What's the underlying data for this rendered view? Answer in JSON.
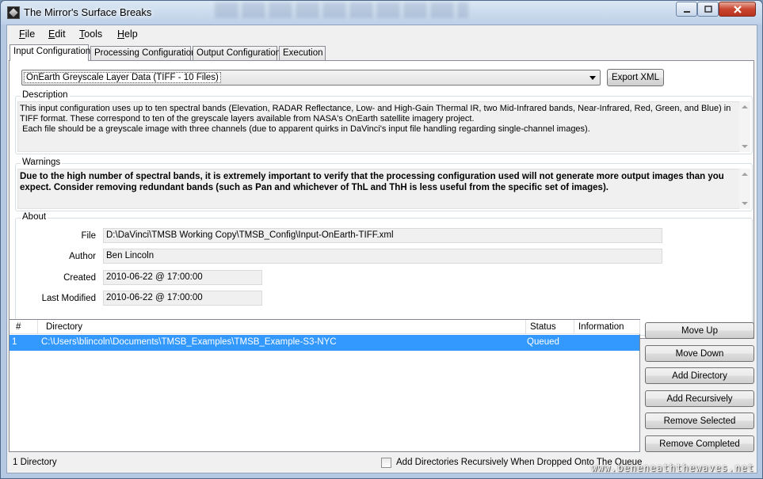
{
  "window": {
    "title": "The Mirror's Surface Breaks"
  },
  "menu": {
    "items": [
      {
        "label": "File",
        "mnemonic": "F",
        "rest": "ile"
      },
      {
        "label": "Edit",
        "mnemonic": "E",
        "rest": "dit"
      },
      {
        "label": "Tools",
        "mnemonic": "T",
        "rest": "ools"
      },
      {
        "label": "Help",
        "mnemonic": "H",
        "rest": "elp"
      }
    ]
  },
  "tabs": [
    {
      "label": "Input Configuration",
      "active": true
    },
    {
      "label": "Processing Configuration",
      "active": false
    },
    {
      "label": "Output Configuration",
      "active": false
    },
    {
      "label": "Execution",
      "active": false
    }
  ],
  "input_config": {
    "selected": "OnEarth Greyscale Layer Data (TIFF - 10 Files)",
    "export_button": "Export XML",
    "description_label": "Description",
    "description_text": "This input configuration uses up to ten spectral bands (Elevation, RADAR Reflectance, Low- and High-Gain Thermal IR, two Mid-Infrared bands, Near-Infrared, Red, Green, and Blue) in TIFF format. These correspond to ten of the greyscale layers available from NASA's OnEarth satellite imagery project.\n Each file should be a greyscale image with three channels (due to apparent quirks in DaVinci's input file handling regarding single-channel images).",
    "warnings_label": "Warnings",
    "warnings_text": "Due to the high number of spectral bands, it is extremely important to verify that the processing configuration used will not generate more output images than you expect. Consider removing redundant bands (such as Pan and whichever of ThL and ThH is less useful from the specific set of images).",
    "about_label": "About",
    "about": {
      "file_label": "File",
      "file_value": "D:\\DaVinci\\TMSB Working Copy\\TMSB_Config\\Input-OnEarth-TIFF.xml",
      "author_label": "Author",
      "author_value": "Ben Lincoln",
      "created_label": "Created",
      "created_value": "2010-06-22 @ 17:00:00",
      "modified_label": "Last Modified",
      "modified_value": "2010-06-22 @ 17:00:00"
    }
  },
  "queue": {
    "columns": [
      "#",
      "Directory",
      "Status",
      "Information"
    ],
    "rows": [
      {
        "num": "1",
        "directory": "C:\\Users\\blincoln\\Documents\\TMSB_Examples\\TMSB_Example-S3-NYC",
        "status": "Queued",
        "information": ""
      }
    ]
  },
  "queue_buttons": {
    "move_up": "Move Up",
    "move_down": "Move Down",
    "add_directory": "Add Directory",
    "add_recursively": "Add Recursively",
    "remove_selected": "Remove Selected",
    "remove_completed": "Remove Completed"
  },
  "statusbar": {
    "count": "1 Directory",
    "recursive_checkbox_label": "Add Directories Recursively When Dropped Onto The Queue",
    "recursive_checked": false
  },
  "watermark": "www.beneneaththewaves.net",
  "colors": {
    "selection": "#3399ff",
    "close_button": "#c9452f"
  }
}
